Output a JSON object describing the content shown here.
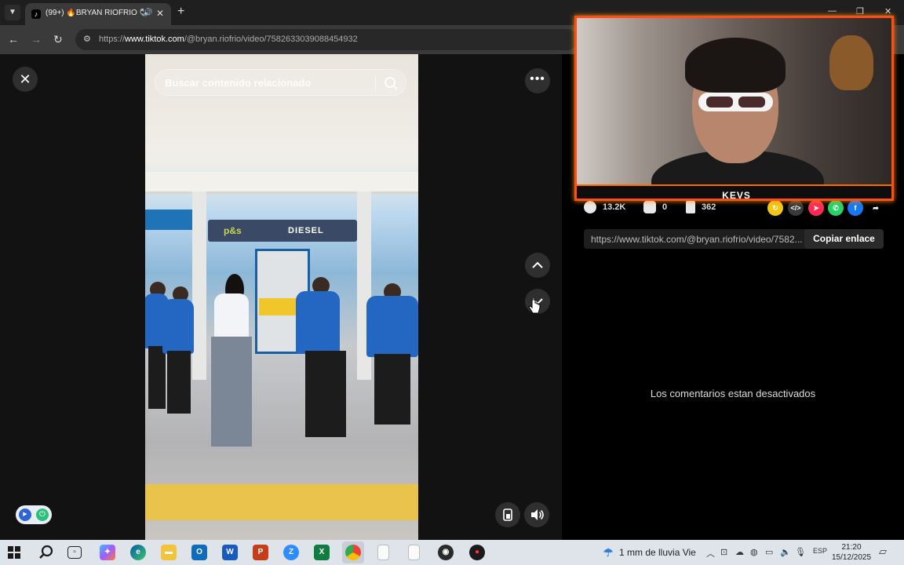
{
  "browser": {
    "tab_title": "(99+) 🔥BRYAN RIOFRIO 👽",
    "tab_audio_icon": "🔊",
    "tab_close": "✕",
    "new_tab": "+",
    "url_prefix": "https://",
    "url_domain": "www.tiktok.com",
    "url_path": "/@bryan.riofrio/video/7582633039088454932",
    "window_controls": {
      "minimize": "—",
      "restore": "❐",
      "close": "✕"
    }
  },
  "player": {
    "close_icon": "✕",
    "search_placeholder": "Buscar contenido relacionado",
    "more_icon": "•••",
    "video_sign_brand": "p&s",
    "video_sign_diesel": "DIESEL"
  },
  "stats": {
    "likes": "13.2K",
    "comments": "0",
    "saves": "362"
  },
  "share": {
    "link_url": "https://www.tiktok.com/@bryan.riofrio/video/7582...",
    "copy_label": "Copiar enlace",
    "icons": [
      {
        "name": "repost-icon",
        "glyph": "↻",
        "color": "#f5c518"
      },
      {
        "name": "embed-icon",
        "glyph": "</>",
        "color": "#3a3a3a"
      },
      {
        "name": "send-icon",
        "glyph": "➤",
        "color": "#fe2c55"
      },
      {
        "name": "whatsapp-icon",
        "glyph": "✆",
        "color": "#25d366"
      },
      {
        "name": "facebook-icon",
        "glyph": "f",
        "color": "#1877f2"
      },
      {
        "name": "share-arrow-icon",
        "glyph": "➦",
        "color": "transparent"
      }
    ]
  },
  "comments_disabled_text": "Los comentarios estan desactivados",
  "webcam": {
    "streamer_name": "KEVS"
  },
  "taskbar": {
    "weather": "1 mm de lluvia Vie",
    "language": "ESP",
    "time": "21:20",
    "date": "15/12/2025"
  }
}
